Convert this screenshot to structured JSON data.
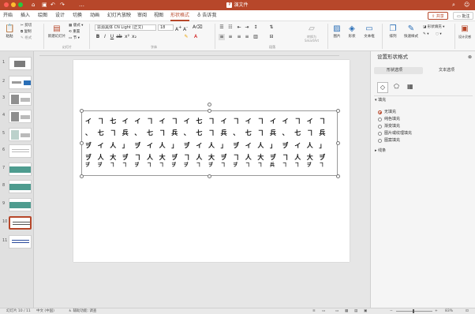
{
  "app": {
    "doc_title": "演文件",
    "share_label": "共享",
    "comment_label": "批注",
    "tabs": [
      "开始",
      "插入",
      "绘图",
      "设计",
      "切换",
      "动画",
      "幻灯片放映",
      "审阅",
      "视图",
      "形状格式",
      "告诉我"
    ],
    "active_tab": "形状格式",
    "accent": "#b7472a"
  },
  "ribbon": {
    "paste_label": "粘贴",
    "cut_label": "剪切",
    "copy_label": "复制",
    "format_label": "格式",
    "new_slide_label": "新建幻灯片",
    "layout_label": "版式",
    "reset_label": "重置",
    "section_label": "节",
    "font_name": "思源黑体 CN Light (正文)",
    "font_size": "18",
    "convert_smartart_label": "转换为 SmartArt",
    "picture_label": "图片",
    "shape_label": "形状",
    "textbox_label": "文本框",
    "arrange_label": "排列",
    "quick_styles_label": "快速样式",
    "shape_fill_label": "形状填充",
    "design_ideas_label": "设计灵感",
    "groups": {
      "clipboard": "",
      "slides": "幻灯片",
      "font": "字体",
      "paragraph": "段落"
    }
  },
  "slides": {
    "numbers": [
      "1",
      "2",
      "3",
      "4",
      "5",
      "6",
      "7",
      "8",
      "9",
      "10",
      "11"
    ],
    "selected_index": 10
  },
  "slide_content": {
    "rows": [
      [
        "イ",
        "ヿ",
        "七",
        "イ",
        "イ",
        "ヿ",
        "イ",
        "ヿ",
        "イ",
        "七",
        "ヿ",
        "イ",
        "ヿ",
        "イ",
        "ヿ",
        "イ",
        "イ",
        "ヿ",
        "イ",
        "ヿ"
      ],
      [
        "、",
        "七",
        "ヿ",
        "兵",
        "、",
        "七",
        "ヿ",
        "兵",
        "、",
        "七",
        "ヿ",
        "兵",
        "、",
        "七",
        "ヿ",
        "兵",
        "、",
        "七",
        "ヿ",
        "兵"
      ],
      [
        "ヺ",
        "イ",
        "人",
        "」",
        "ヺ",
        "イ",
        "人",
        "」",
        "ヺ",
        "イ",
        "人",
        "」",
        "ヺ",
        "イ",
        "人",
        "」",
        "ヺ",
        "イ",
        "人",
        "」"
      ],
      [
        "ヺ",
        "人",
        "大",
        "ヺ",
        "ヿ",
        "人",
        "大",
        "ヺ",
        "ヿ",
        "人",
        "大",
        "ヺ",
        "ヿ",
        "人",
        "大",
        "ヺ",
        "ヿ",
        "人",
        "大",
        "ヺ"
      ],
      [
        "ヺ",
        "ヺ",
        "ヿ",
        "ヿ",
        "ヺ",
        "ヿ",
        "ヿ",
        "ヺ",
        "ヺ",
        "ヿ",
        "ヺ",
        "ヿ",
        "ヺ",
        "ヿ",
        "ヿ",
        "兵",
        "ヿ",
        "ヿ",
        "ヺ",
        "ヿ"
      ]
    ]
  },
  "format_pane": {
    "title": "设置形状格式",
    "tab_shape": "形状选项",
    "tab_text": "文本选项",
    "section_fill": "填充",
    "fill_options": [
      "无填充",
      "纯色填充",
      "渐变填充",
      "图片或纹理填充",
      "图案填充"
    ],
    "selected_fill": "无填充",
    "section_line": "线条"
  },
  "status": {
    "slide_pos": "幻灯片 10 / 11",
    "language": "中文 (中国)",
    "accessibility": "辅助功能: 调查",
    "zoom": "83%"
  }
}
